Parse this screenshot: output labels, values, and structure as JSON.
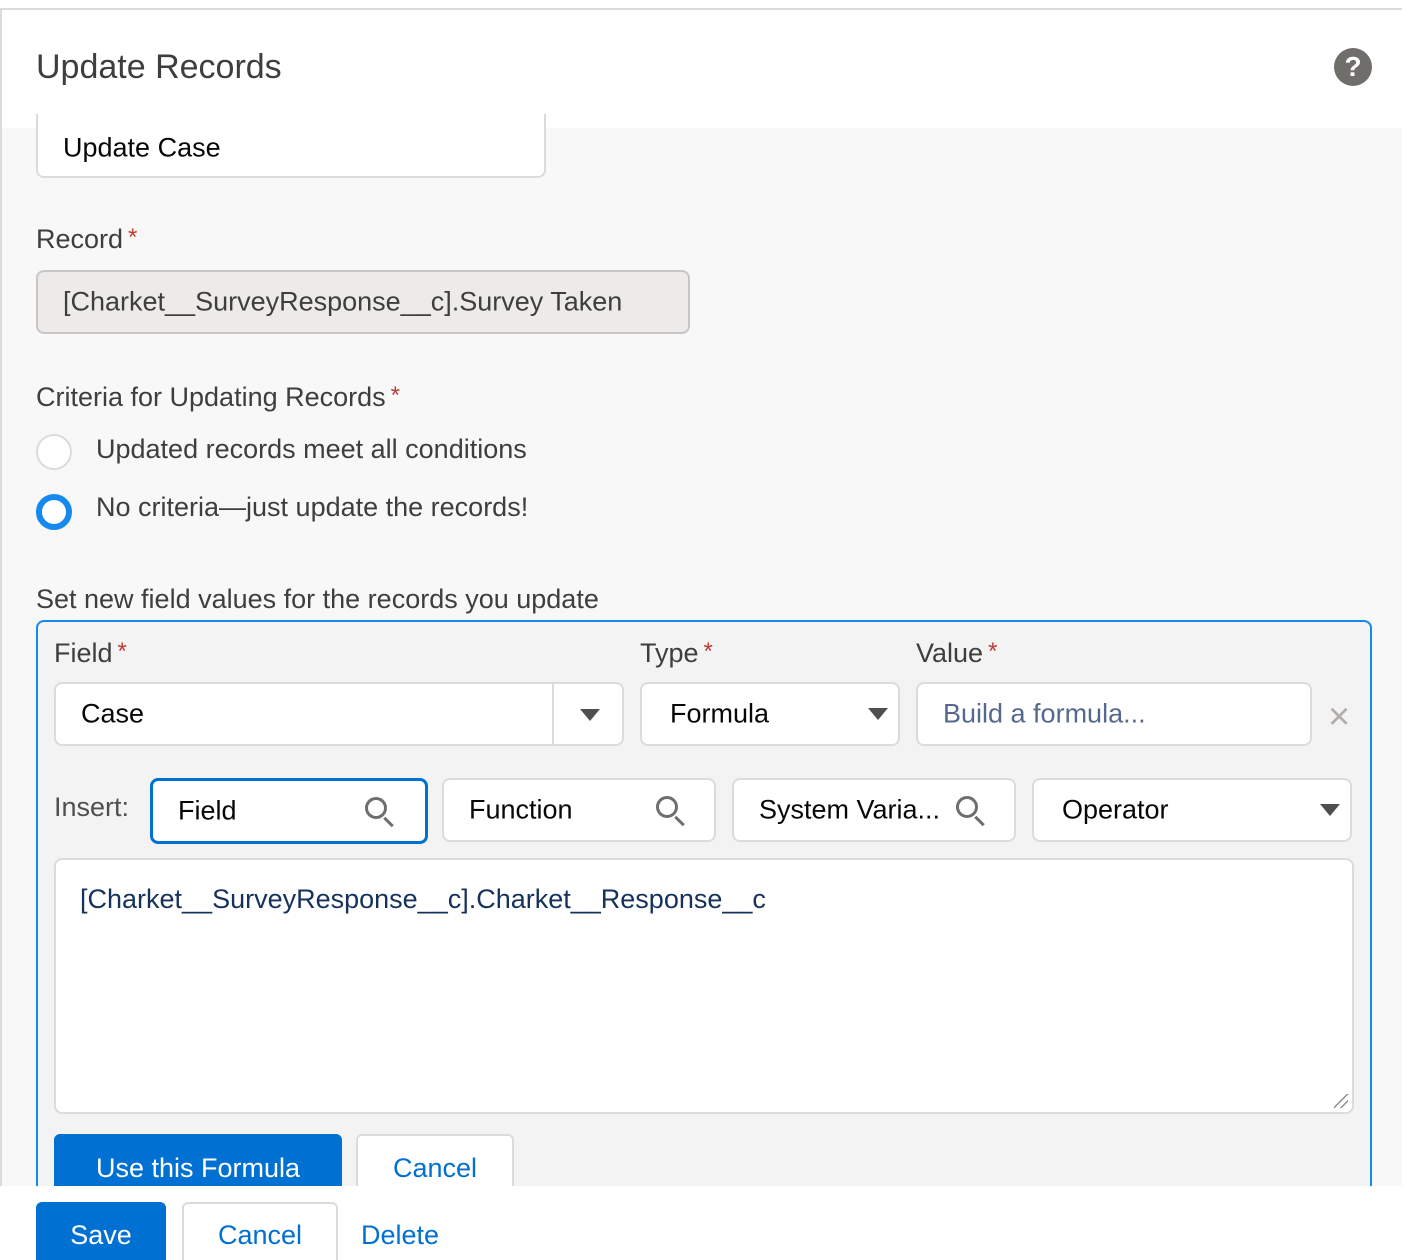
{
  "header": {
    "title": "Update Records",
    "help_icon": "?"
  },
  "action_name": {
    "value": "Update Case"
  },
  "record": {
    "label": "Record",
    "required_mark": "*",
    "value": "[Charket__SurveyResponse__c].Survey Taken"
  },
  "criteria": {
    "label": "Criteria for Updating Records",
    "required_mark": "*",
    "options": [
      {
        "label": "Updated records meet all conditions",
        "checked": false
      },
      {
        "label": "No criteria—just update the records!",
        "checked": true
      }
    ]
  },
  "field_values": {
    "label": "Set new field values for the records you update",
    "field_label": "Field",
    "type_label": "Type",
    "value_label": "Value",
    "required_mark": "*",
    "field_value": "Case",
    "type_value": "Formula",
    "value_placeholder": "Build a formula...",
    "remove_icon": "×"
  },
  "insert": {
    "label": "Insert:",
    "field": "Field",
    "function": "Function",
    "system_variable": "System Varia...",
    "operator": "Operator"
  },
  "formula": {
    "text": "[Charket__SurveyResponse__c].Charket__Response__c",
    "use_button": "Use this Formula",
    "cancel_button": "Cancel"
  },
  "footer": {
    "save": "Save",
    "cancel": "Cancel",
    "delete": "Delete"
  },
  "colors": {
    "brand": "#0070d2",
    "focus": "#1589ee",
    "required": "#c23934"
  }
}
